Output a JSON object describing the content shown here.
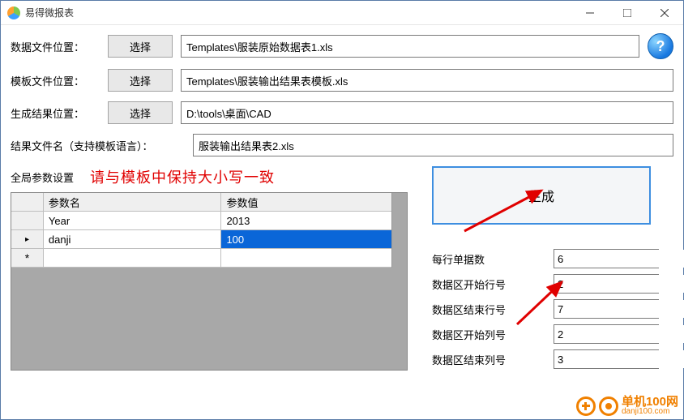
{
  "window": {
    "title": "易得微报表"
  },
  "labels": {
    "data_file": "数据文件位置：",
    "template_file": "模板文件位置：",
    "output_loc": "生成结果位置：",
    "output_name": "结果文件名（支持模板语言）：",
    "global_params": "全局参数设置",
    "choose": "选择"
  },
  "inputs": {
    "data_file": "Templates\\服装原始数据表1.xls",
    "template_file": "Templates\\服装输出结果表模板.xls",
    "output_loc": "D:\\tools\\桌面\\CAD",
    "output_name": "服装输出结果表2.xls"
  },
  "note": "请与模板中保持大小写一致",
  "grid": {
    "headers": {
      "name": "参数名",
      "value": "参数值"
    },
    "rows": [
      {
        "name": "Year",
        "value": "2013",
        "selected": false
      },
      {
        "name": "danji",
        "value": "100",
        "selected": true
      }
    ]
  },
  "generate_label": "生成",
  "spinners": [
    {
      "label": "每行单据数",
      "value": "6"
    },
    {
      "label": "数据区开始行号",
      "value": "2"
    },
    {
      "label": "数据区结束行号",
      "value": "7"
    },
    {
      "label": "数据区开始列号",
      "value": "2"
    },
    {
      "label": "数据区结束列号",
      "value": "3"
    }
  ],
  "watermark": {
    "line1": "单机100网",
    "line2": "danji100.com"
  }
}
